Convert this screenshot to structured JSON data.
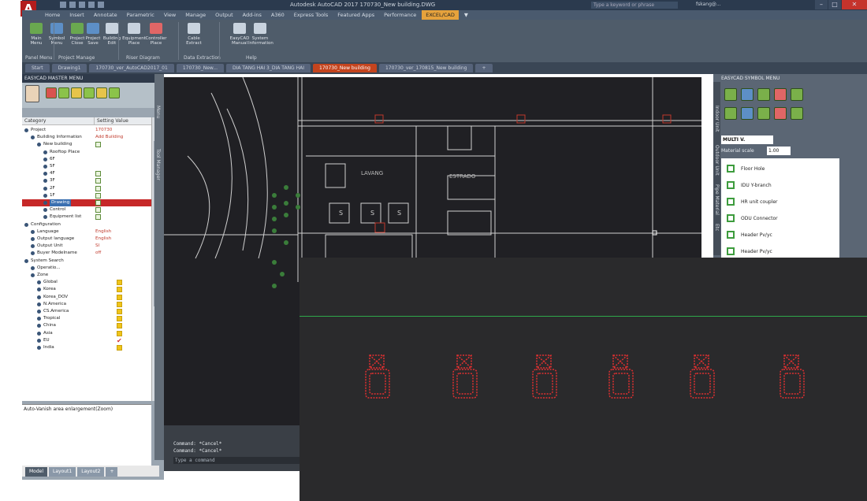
{
  "titlebar": {
    "title": "Autodesk AutoCAD 2017    170730_New building.DWG",
    "search_placeholder": "Type a keyword or phrase",
    "user": "fskang@...",
    "minimize": "–",
    "maximize": "□",
    "close": "✕"
  },
  "app_logo": "A",
  "ribbon_tabs": [
    "Home",
    "Insert",
    "Annotate",
    "Parametric",
    "View",
    "Manage",
    "Output",
    "Add-ins",
    "A360",
    "Express Tools",
    "Featured Apps",
    "Performance",
    "EXCEL/CAD",
    "▼"
  ],
  "ribbon_active_tab": "EXCEL/CAD",
  "ribbon": {
    "buttons": [
      {
        "label": "Main\nMenu",
        "color": "#6aa84f"
      },
      {
        "label": "Symbol\nMenu",
        "color": "#5d8fc6"
      },
      {
        "label": "Project\nClose",
        "color": "#6aa84f"
      },
      {
        "label": "Project\nSave",
        "color": "#5d8fc6"
      },
      {
        "label": "Building\nEdit",
        "color": "#c9d3de"
      },
      {
        "label": "Equipment\nPlace",
        "color": "#c9d3de"
      },
      {
        "label": "Controller\nPlace",
        "color": "#e06666"
      },
      {
        "label": "Cable\nExtract",
        "color": "#c9d3de"
      },
      {
        "label": "EasyCAD\nManual",
        "color": "#c9d3de"
      },
      {
        "label": "System\nInformation",
        "color": "#c9d3de"
      }
    ],
    "groups": [
      "Panel Menu",
      "Project Manage",
      "Riser Diagram",
      "Data Extraction",
      "Help"
    ]
  },
  "doc_tabs": [
    "Start",
    "Drawing1",
    "170730_ver_AutoCAD2017_01",
    "170730_New...",
    "DIA TANG HAI 3_DIA TANG HAI",
    "170730_New building",
    "170730_ver_170815_New building",
    "+"
  ],
  "doc_tab_active": 5,
  "left_panel": {
    "title": "EASYCAD MASTER MENU",
    "columns": [
      "Category",
      "Setting Value"
    ],
    "rows": [
      {
        "label": "Project",
        "value": "170730",
        "indent": 0
      },
      {
        "label": "Building Information",
        "value": "Add Building",
        "indent": 1
      },
      {
        "label": "New building",
        "indent": 2,
        "check": true
      },
      {
        "label": "Rooftop Place",
        "indent": 3
      },
      {
        "label": "6F",
        "indent": 3
      },
      {
        "label": "5F",
        "indent": 3
      },
      {
        "label": "4F",
        "indent": 3,
        "check": true
      },
      {
        "label": "3F",
        "indent": 3,
        "check": true
      },
      {
        "label": "2F",
        "indent": 3,
        "check": true
      },
      {
        "label": "1F",
        "indent": 3,
        "check": true
      },
      {
        "label": "Drawing",
        "indent": 3,
        "check": true,
        "selected": true
      },
      {
        "label": "Control",
        "indent": 3,
        "check": true
      },
      {
        "label": "Equipment list",
        "indent": 3,
        "check": true
      },
      {
        "label": "Configuration",
        "indent": 0
      },
      {
        "label": "Language",
        "value": "English",
        "indent": 1
      },
      {
        "label": "Output language",
        "value": "English",
        "indent": 1
      },
      {
        "label": "Output Unit",
        "value": "SI",
        "indent": 1
      },
      {
        "label": "Buyer Modelname",
        "value": "off",
        "indent": 1
      },
      {
        "label": "System Search",
        "indent": 0
      },
      {
        "label": "Operatio...",
        "indent": 1
      },
      {
        "label": "Zone",
        "indent": 1
      },
      {
        "label": "Global",
        "indent": 2,
        "yellow": true
      },
      {
        "label": "Korea",
        "indent": 2,
        "yellow": true
      },
      {
        "label": "Korea_DOV",
        "indent": 2,
        "yellow": true
      },
      {
        "label": "N.America",
        "indent": 2,
        "yellow": true
      },
      {
        "label": "CS.America",
        "indent": 2,
        "yellow": true
      },
      {
        "label": "Tropical",
        "indent": 2,
        "yellow": true
      },
      {
        "label": "China",
        "indent": 2,
        "yellow": true
      },
      {
        "label": "Asia",
        "indent": 2,
        "yellow": true
      },
      {
        "label": "EU",
        "indent": 2,
        "red_check": true
      },
      {
        "label": "India",
        "indent": 2,
        "yellow": true
      }
    ],
    "description": "Auto-Vanish area enlargement(Zoom)",
    "vertical_tabs": [
      "Menu",
      "Tool Manager"
    ]
  },
  "canvas": {
    "labels": [
      "LAVANG",
      "ESTRADO",
      "S",
      "S",
      "S"
    ]
  },
  "command": {
    "lines": [
      "Command: *Cancel*",
      "Command: *Cancel*"
    ],
    "prompt": "Type a command"
  },
  "layout_tabs": [
    "Model",
    "Layout1",
    "Layout2",
    "+"
  ],
  "right_panel": {
    "title": "EASYCAD SYMBOL MENU",
    "select_value": "MULTI V.",
    "material_label": "Material scale",
    "material_value": "1.00",
    "symbols": [
      "Floor Hole",
      "IDU Y-branch",
      "HR unit coupler",
      "ODU Connector",
      "Header Pv/yc",
      "Header Pv/yc"
    ],
    "vertical_tabs": [
      "Indoor Unit",
      "Outdoor Unit",
      "Pipe Material",
      "Etc"
    ]
  }
}
